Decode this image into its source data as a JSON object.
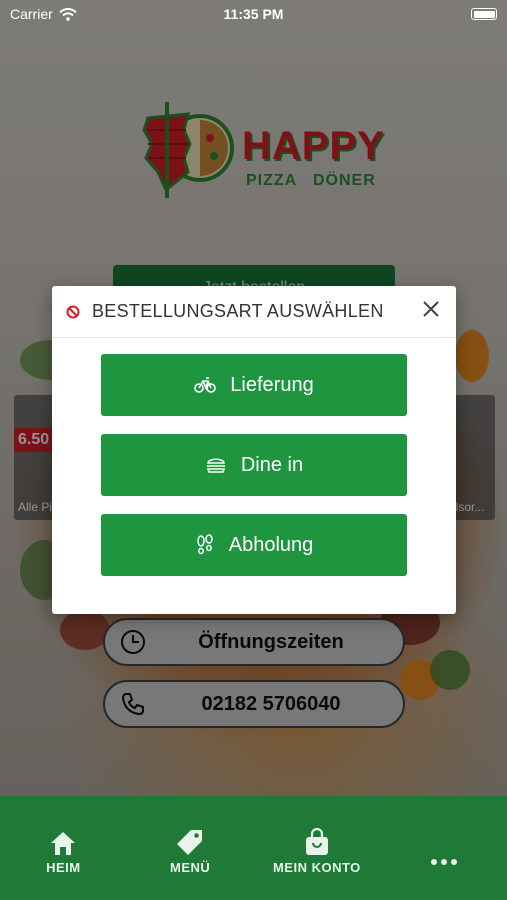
{
  "status_bar": {
    "carrier": "Carrier",
    "time": "11:35 PM"
  },
  "logo": {
    "brand": "HAPPY",
    "sub": "PIZZA   DÖNER"
  },
  "background": {
    "order_button_label": "Jetzt bestellen",
    "left_card": {
      "price": "6.50",
      "label": "Alle Pi"
    },
    "right_card": {
      "label": "elsor..."
    }
  },
  "info": {
    "hours_label": "Öffnungszeiten",
    "phone": "02182 5706040"
  },
  "modal": {
    "title": "BESTELLUNGSART AUSWÄHLEN",
    "options": [
      {
        "label": "Lieferung",
        "icon": "bicycle-icon"
      },
      {
        "label": "Dine in",
        "icon": "burger-icon"
      },
      {
        "label": "Abholung",
        "icon": "footsteps-icon"
      }
    ]
  },
  "tabbar": {
    "items": [
      {
        "label": "HEIM",
        "icon": "home-icon"
      },
      {
        "label": "MENÜ",
        "icon": "tag-icon"
      },
      {
        "label": "MEIN KONTO",
        "icon": "bag-icon"
      },
      {
        "label": "",
        "icon": "more-icon"
      }
    ]
  },
  "colors": {
    "accent_green": "#1f9540",
    "tabbar_green": "#1f7a38",
    "brand_red": "#d81e2a"
  }
}
